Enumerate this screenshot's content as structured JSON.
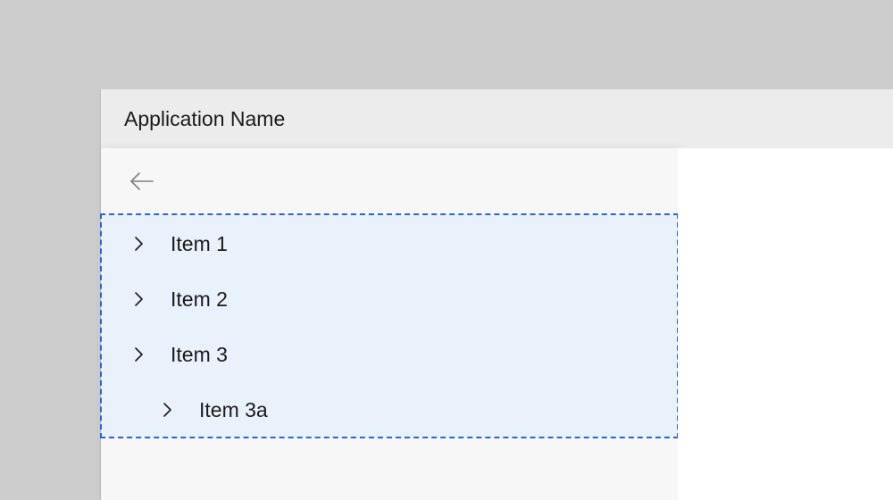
{
  "titlebar": {
    "title": "Application Name"
  },
  "nav": {
    "items": [
      {
        "label": "Item 1",
        "depth": 0
      },
      {
        "label": "Item 2",
        "depth": 0
      },
      {
        "label": "Item 3",
        "depth": 0
      },
      {
        "label": "Item 3a",
        "depth": 1
      }
    ]
  },
  "colors": {
    "highlight_bg": "#e9f1fb",
    "highlight_border": "#2b66d9",
    "pane_bg": "#f7f7f7",
    "titlebar_bg": "#ececec",
    "desktop_bg": "#cccccc"
  }
}
